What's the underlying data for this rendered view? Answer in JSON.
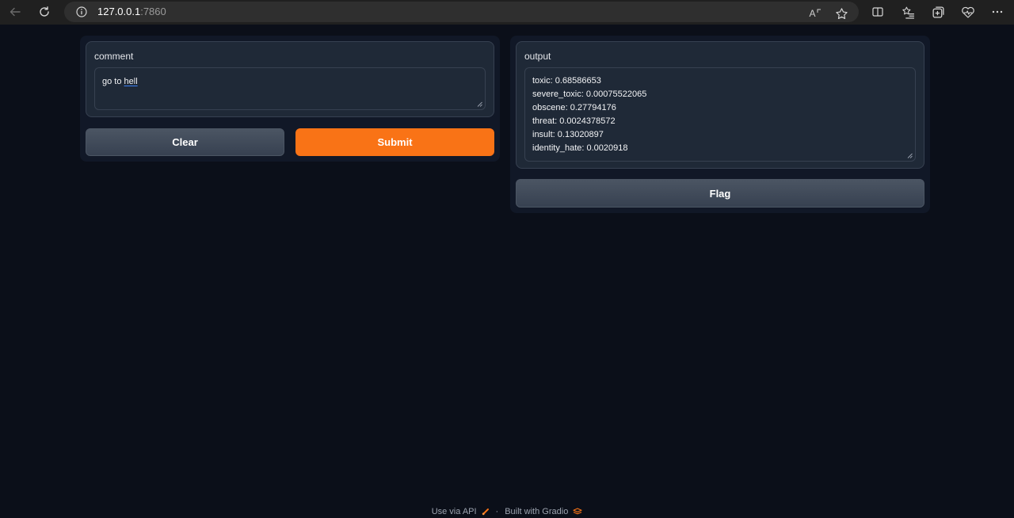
{
  "browser": {
    "url_host": "127.0.0.1",
    "url_port": ":7860",
    "icons": [
      "back-arrow-icon",
      "reload-icon",
      "info-icon",
      "read-aloud-icon",
      "favorite-star-icon",
      "split-screen-icon",
      "favorites-list-icon",
      "collections-icon",
      "browser-essentials-icon",
      "more-options-icon"
    ],
    "read_aloud_text": "A"
  },
  "input_panel": {
    "label": "comment",
    "value_plain": "go to ",
    "value_marked": "hell",
    "clear_label": "Clear",
    "submit_label": "Submit"
  },
  "output_panel": {
    "label": "output",
    "lines": [
      "toxic: 0.68586653",
      "severe_toxic: 0.00075522065",
      "obscene: 0.27794176",
      "threat: 0.0024378572",
      "insult: 0.13020897",
      "identity_hate: 0.0020918"
    ],
    "flag_label": "Flag"
  },
  "footer": {
    "api_link": "Use via API",
    "separator": "·",
    "built_with": "Built with Gradio"
  },
  "colors": {
    "background": "#0b0f19",
    "panel": "#111827",
    "block": "#1f2937",
    "accent": "#f97316",
    "secondary_button": "#4b5563"
  }
}
